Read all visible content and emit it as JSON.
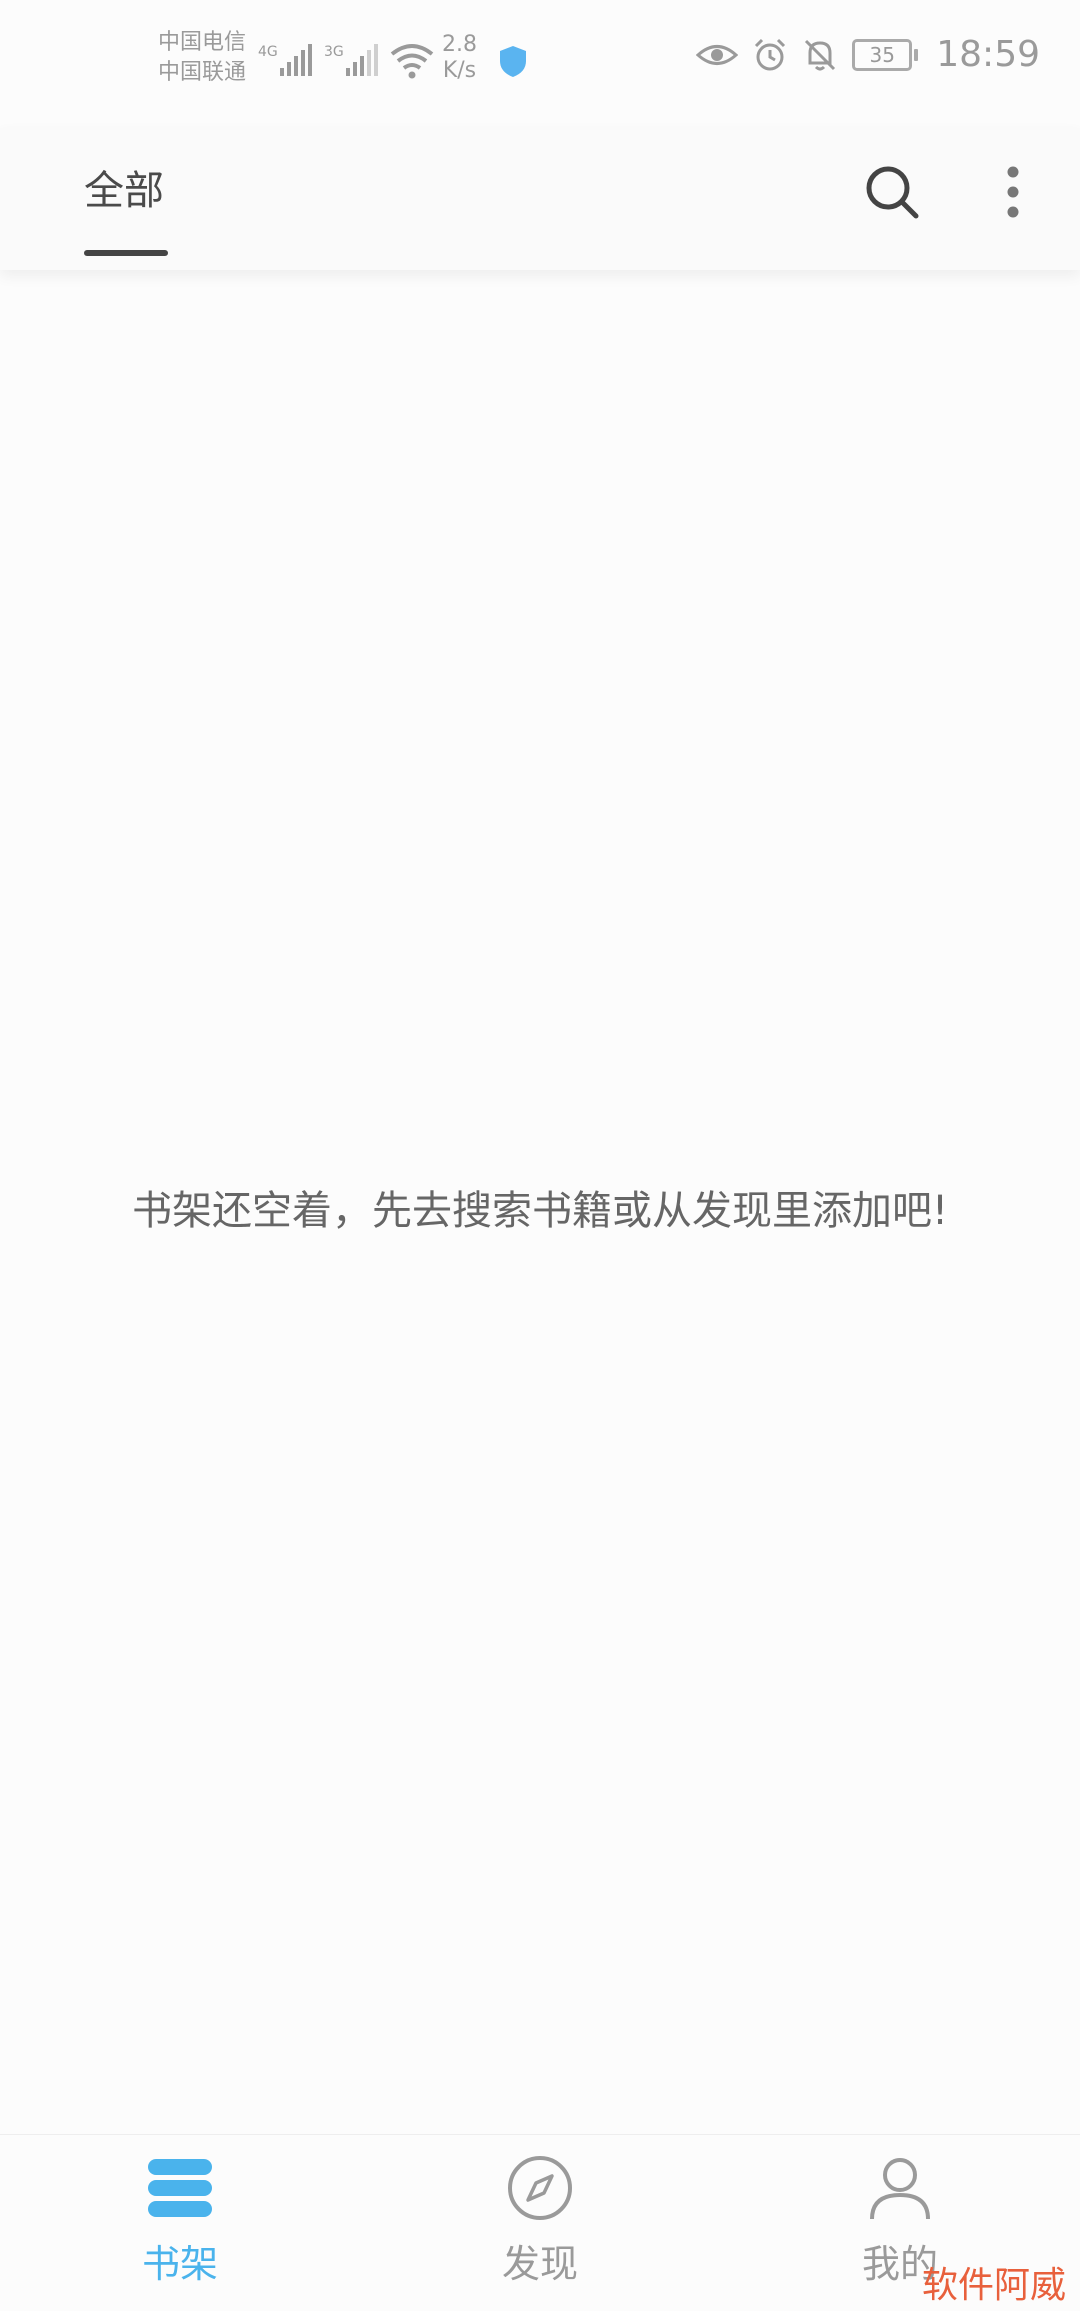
{
  "status_bar": {
    "carrier_1": "中国电信",
    "carrier_2": "中国联通",
    "network_1": "4G",
    "network_2": "3G",
    "speed_value": "2.8",
    "speed_unit": "K/s",
    "battery": "35",
    "time": "18:59"
  },
  "toolbar": {
    "tab_label": "全部"
  },
  "main": {
    "empty_message": "书架还空着，先去搜索书籍或从发现里添加吧!"
  },
  "bottom_nav": {
    "items": [
      {
        "label": "书架",
        "active": true
      },
      {
        "label": "发现",
        "active": false
      },
      {
        "label": "我的",
        "active": false
      }
    ]
  },
  "watermark": "软件阿威",
  "colors": {
    "accent": "#4ab3ec",
    "inactive": "#9a9a9a",
    "watermark": "#e8603c"
  }
}
